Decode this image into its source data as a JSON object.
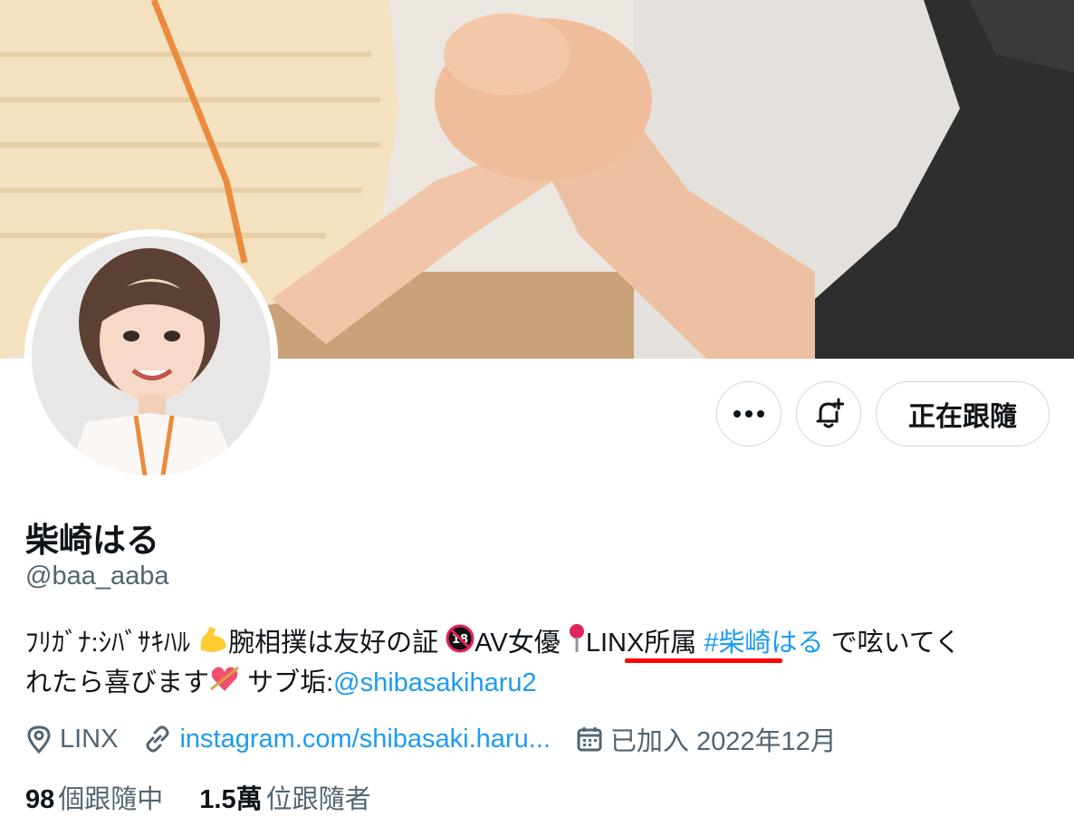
{
  "profile": {
    "display_name": "柴崎はる",
    "handle": "@baa_aaba",
    "bio": {
      "part1": "ﾌﾘｶﾞﾅ:ｼﾊﾞｻｷﾊﾙ",
      "part2": "腕相撲は友好の証",
      "part3": "AV女優",
      "part4": "LINX所属",
      "hashtag": "#柴崎はる",
      "part5": "で呟いてく",
      "part6": "れたら喜びます",
      "part7": "サブ垢:",
      "mention": "@shibasakiharu2"
    },
    "location": "LINX",
    "website": "instagram.com/shibasaki.haru...",
    "joined": "已加入 2022年12月"
  },
  "actions": {
    "more_icon": "more-horizontal-icon",
    "notify_icon": "bell-plus-icon",
    "follow_label": "正在跟隨"
  },
  "stats": {
    "following_count": "98",
    "following_label": "個跟隨中",
    "followers_count": "1.5萬",
    "followers_label": "位跟隨者"
  },
  "icons": {
    "location": "location-pin-icon",
    "website": "link-icon",
    "joined": "calendar-icon"
  },
  "colors": {
    "link": "#1d9bf0",
    "secondary_text": "#536471",
    "annotation_underline": "#ff0000"
  }
}
